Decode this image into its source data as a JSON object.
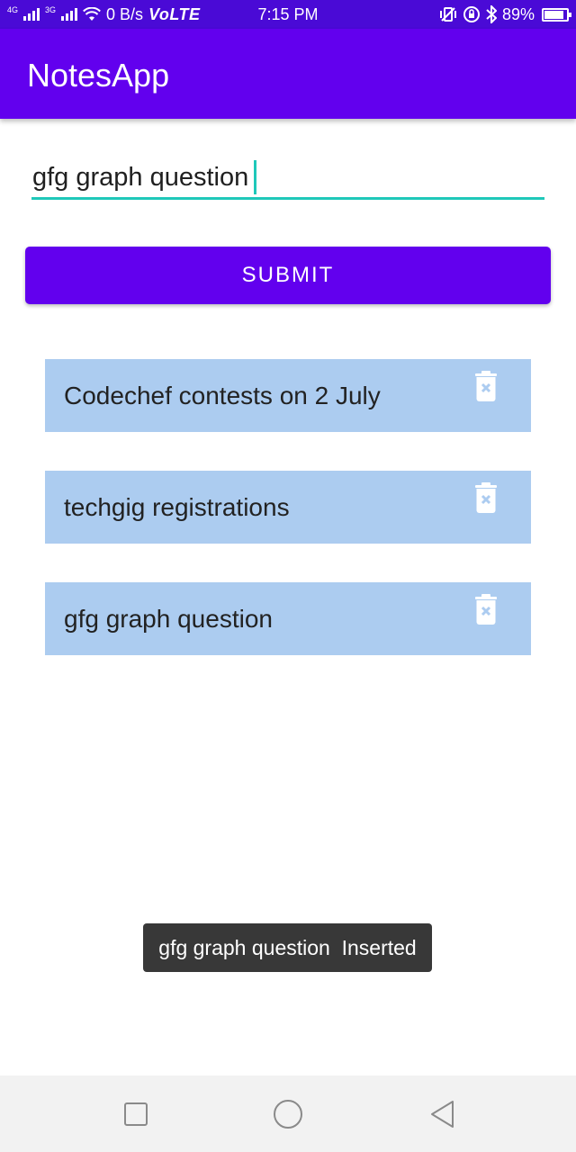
{
  "status_bar": {
    "network_label_1": "4G",
    "network_label_2": "3G",
    "speed": "0 B/s",
    "volte": "VoLTE",
    "time": "7:15 PM",
    "battery": "89%",
    "battery_level": 0.89
  },
  "app_bar": {
    "title": "NotesApp"
  },
  "note_input": {
    "value": "gfg graph question"
  },
  "submit": {
    "label": "SUBMIT"
  },
  "notes": [
    {
      "text": "Codechef contests on 2 July"
    },
    {
      "text": "techgig registrations"
    },
    {
      "text": "gfg graph question"
    }
  ],
  "toast": {
    "text": "gfg graph question  Inserted"
  },
  "colors": {
    "primary": "#6200ee",
    "status_bar": "#4a0ad6",
    "accent": "#1fc8b9",
    "note_bg": "#acccf0",
    "delete_icon": "#ffffff"
  },
  "icons": {
    "delete": "trash-icon",
    "nav_recent": "square-icon",
    "nav_home": "circle-icon",
    "nav_back": "triangle-back-icon"
  }
}
